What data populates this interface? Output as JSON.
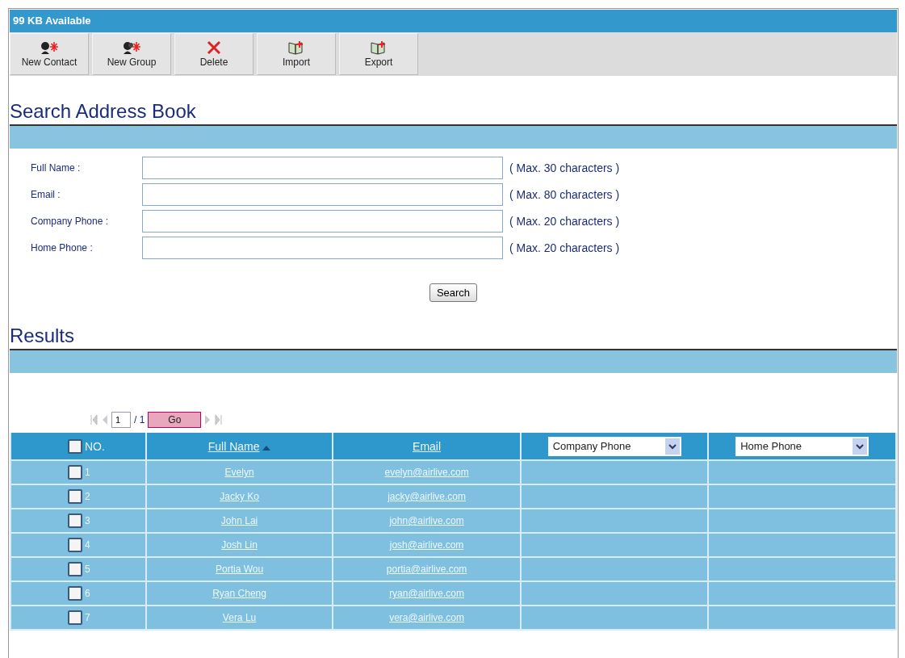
{
  "header": {
    "title": "99 KB Available"
  },
  "toolbar": [
    {
      "label": "New Contact",
      "kind": "contact"
    },
    {
      "label": "New Group",
      "kind": "group"
    },
    {
      "label": "Delete",
      "kind": "delete"
    },
    {
      "label": "Import",
      "kind": "import"
    },
    {
      "label": "Export",
      "kind": "export"
    }
  ],
  "search": {
    "title": "Search Address Book",
    "fields": [
      {
        "label": "Full Name :",
        "hint": "( Max. 30 characters )"
      },
      {
        "label": "Email :",
        "hint": "( Max. 80 characters )"
      },
      {
        "label": "Company Phone :",
        "hint": "( Max. 20 characters )"
      },
      {
        "label": "Home Phone :",
        "hint": "( Max. 20 characters )"
      }
    ],
    "button": "Search"
  },
  "results": {
    "title": "Results",
    "pager": {
      "page": "1",
      "total": "/ 1",
      "go": "Go"
    },
    "columns": [
      {
        "label": "NO.",
        "kind": "check",
        "checked": false
      },
      {
        "label": "Full Name",
        "kind": "sort"
      },
      {
        "label": "Email",
        "kind": "link"
      },
      {
        "label": "Company Phone",
        "kind": "select"
      },
      {
        "label": "Home Phone",
        "kind": "select"
      }
    ],
    "rows": [
      {
        "no": "1",
        "name": "Evelyn",
        "email": "evelyn@airlive.com",
        "checked": false
      },
      {
        "no": "2",
        "name": "Jacky Ko",
        "email": "jacky@airlive.com",
        "checked": false
      },
      {
        "no": "3",
        "name": "John Lai",
        "email": "john@airlive.com",
        "checked": false
      },
      {
        "no": "4",
        "name": "Josh Lin",
        "email": "josh@airlive.com",
        "checked": false
      },
      {
        "no": "5",
        "name": "Portia Wou",
        "email": "portia@airlive.com",
        "checked": false
      },
      {
        "no": "6",
        "name": "Ryan Cheng",
        "email": "ryan@airlive.com",
        "checked": false
      },
      {
        "no": "7",
        "name": "Vera Lu",
        "email": "vera@airlive.com",
        "checked": false
      }
    ]
  }
}
